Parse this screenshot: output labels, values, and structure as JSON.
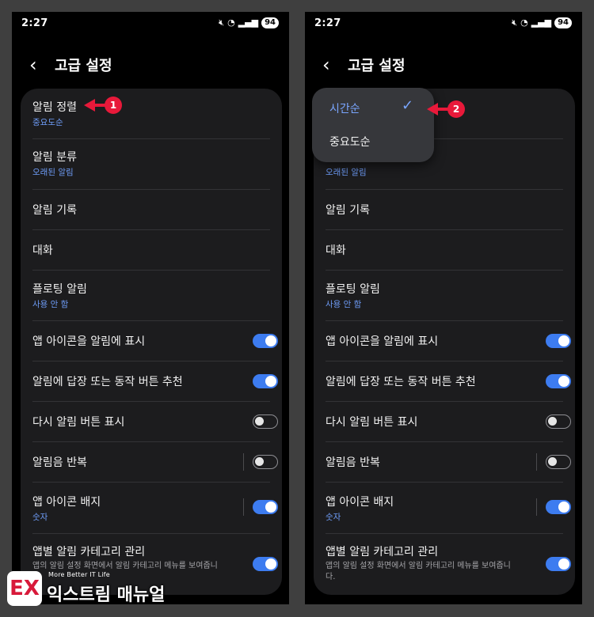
{
  "status": {
    "time": "2:27",
    "battery": "94",
    "mute_icon": "mute-icon",
    "wifi_icon": "wifi-icon",
    "signal_icon": "signal-icon"
  },
  "header": {
    "title": "고급 설정",
    "back_icon": "back-chevron-icon"
  },
  "settings": [
    {
      "label": "알림 정렬",
      "sub": "중요도순"
    },
    {
      "label": "알림 분류",
      "sub": "오래된 알림"
    },
    {
      "label": "알림 기록"
    },
    {
      "label": "대화"
    },
    {
      "label": "플로팅 알림",
      "sub": "사용 안 함"
    },
    {
      "label": "앱 아이콘을 알림에 표시",
      "toggle": true
    },
    {
      "label": "알림에 답장 또는 동작 버튼 추천",
      "toggle": true
    },
    {
      "label": "다시 알림 버튼 표시",
      "toggle": false
    },
    {
      "label": "알림음 반복",
      "toggle": false
    },
    {
      "label": "앱 아이콘 배지",
      "sub": "숫자",
      "toggle": true
    },
    {
      "label": "앱별 알림 카테고리 관리",
      "desc": "앱의 알림 설정 화면에서 알림 카테고리 메뉴를 보여줍니다.",
      "toggle": true
    }
  ],
  "dropdown": {
    "options": [
      "시간순",
      "중요도순"
    ],
    "selected": "시간순"
  },
  "markers": {
    "m1": "1",
    "m2": "2"
  },
  "watermark": {
    "tagline": "More Better IT Life",
    "name": "익스트림 매뉴얼"
  },
  "colors": {
    "accent": "#3d7cf0",
    "link": "#6e9cf7",
    "marker": "#e8193a",
    "card": "#1c1c1e"
  }
}
